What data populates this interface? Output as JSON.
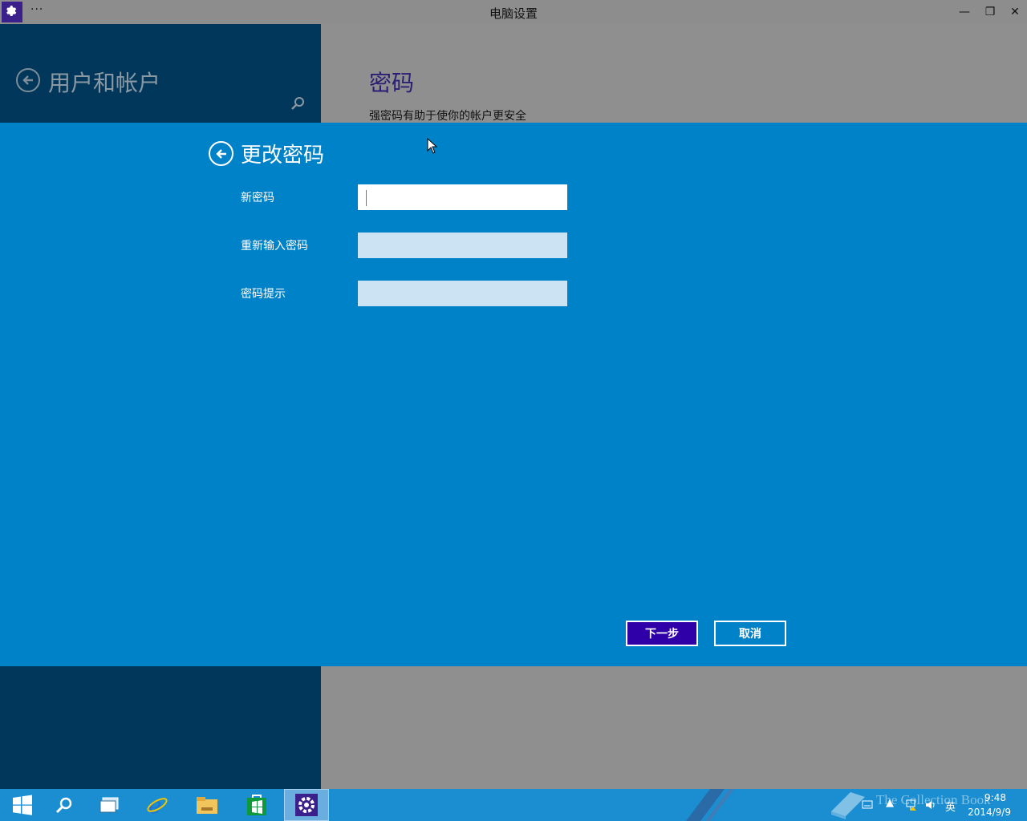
{
  "window": {
    "title": "电脑设置",
    "menu": "···",
    "minimize": "—",
    "restore": "❐",
    "close": "✕"
  },
  "sidebar": {
    "title": "用户和帐户"
  },
  "page": {
    "heading": "密码",
    "description": "强密码有助于使你的帐户更安全"
  },
  "dialog": {
    "title": "更改密码",
    "fields": [
      {
        "label": "新密码",
        "value": ""
      },
      {
        "label": "重新输入密码",
        "value": ""
      },
      {
        "label": "密码提示",
        "value": ""
      }
    ],
    "next_label": "下一步",
    "cancel_label": "取消"
  },
  "taskbar": {
    "items": [
      "start",
      "search",
      "task-view",
      "internet-explorer",
      "file-explorer",
      "store",
      "settings"
    ],
    "active": "settings",
    "tray": {
      "ime": "英",
      "time": "9:48",
      "date": "2014/9/9",
      "watermark": "The Collection Book"
    }
  },
  "colors": {
    "titlebar": "#8d8d8d",
    "left_pane": "#00375a",
    "right_pane": "#8f8f8f",
    "dialog_bg": "#0082c9",
    "next_button": "#2f00a8",
    "taskbar": "#1a8ed0"
  }
}
